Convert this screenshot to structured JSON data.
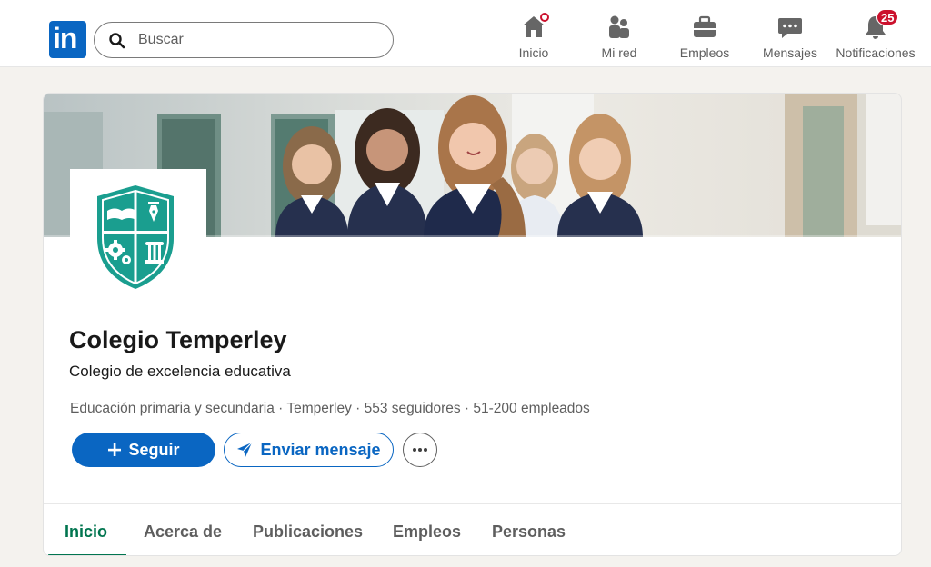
{
  "nav": {
    "search_placeholder": "Buscar",
    "items": [
      {
        "label": "Inicio",
        "icon": "home-icon",
        "badge": "dot"
      },
      {
        "label": "Mi red",
        "icon": "network-icon"
      },
      {
        "label": "Empleos",
        "icon": "briefcase-icon"
      },
      {
        "label": "Mensajes",
        "icon": "message-icon"
      },
      {
        "label": "Notificaciones",
        "icon": "bell-icon",
        "badge_count": "25"
      }
    ]
  },
  "profile": {
    "name": "Colegio Temperley",
    "tagline": "Colegio  de excelencia educativa",
    "meta": "Educación primaria y secundaria · Temperley  · 553 seguidores · 51-200 empleados",
    "follow_label": "Seguir",
    "message_label": "Enviar mensaje"
  },
  "tabs": [
    "Inicio",
    "Acerca de",
    "Publicaciones",
    "Empleos",
    "Personas"
  ],
  "colors": {
    "brand": "#0a66c2",
    "active_tab": "#01754f",
    "crest": "#1a9e8f",
    "badge": "#cb112d"
  }
}
